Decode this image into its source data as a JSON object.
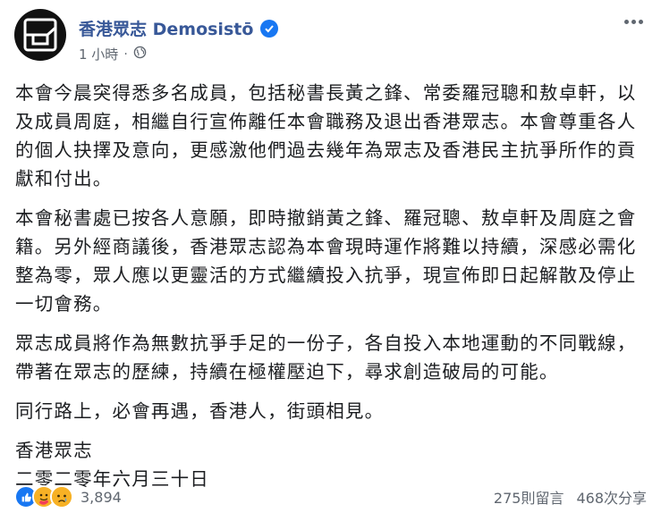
{
  "post": {
    "page_name": "香港眾志 Demosistō",
    "time": "1 小時",
    "separator": "·",
    "paragraphs": [
      "本會今晨突得悉多名成員，包括秘書長黃之鋒、常委羅冠聰和敖卓軒，以及成員周庭，相繼自行宣佈離任本會職務及退出香港眾志。本會尊重各人的個人抉擇及意向，更感激他們過去幾年為眾志及香港民主抗爭所作的貢獻和付出。",
      "本會秘書處已按各人意願，即時撤銷黃之鋒、羅冠聰、敖卓軒及周庭之會籍。另外經商議後，香港眾志認為本會現時運作將難以持續，深感必需化整為零，眾人應以更靈活的方式繼續投入抗爭，現宣佈即日起解散及停止一切會務。",
      "眾志成員將作為無數抗爭手足的一份子，各自投入本地運動的不同戰線，帶著在眾志的歷練，持續在極權壓迫下，尋求創造破局的可能。",
      "同行路上，必會再遇，香港人，街頭相見。",
      "香港眾志\n二零二零年六月三十日"
    ],
    "reactions_count": "3,894",
    "comments": "275則留言",
    "shares": "468次分享"
  },
  "icons": {
    "avatar": "demosisto-logo",
    "verified": "verified-badge-icon",
    "privacy": "globe-icon",
    "more": "more-options-icon",
    "reactions": [
      "like-icon",
      "care-icon",
      "sad-icon"
    ]
  },
  "colors": {
    "page_name": "#385898",
    "verified": "#1877f2",
    "meta": "#606770"
  }
}
